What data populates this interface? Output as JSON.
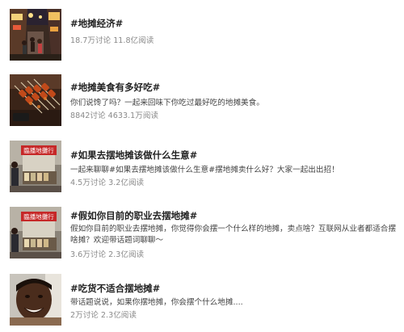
{
  "topics": [
    {
      "title": "#地摊经济#",
      "desc": "",
      "stats": "18.7万讨论 11.8亿阅读",
      "thumb": "night-market-street-photo"
    },
    {
      "title": "#地摊美食有多好吃#",
      "desc": "你们说馋了吗？一起来回味下你吃过最好吃的地摊美食。",
      "stats": "8842讨论 4633.1万阅读",
      "thumb": "street-food-grill-photo"
    },
    {
      "title": "#如果去摆地摊该做什么生意#",
      "desc": "一起来聊聊#如果去摆地摊该做什么生意#摆地摊卖什么好？大家一起出出招！",
      "stats": "4.5万讨论 3.2亿阅读",
      "thumb": "market-stall-sign-photo",
      "sign": "臨播地攤行"
    },
    {
      "title": "#假如你目前的职业去摆地摊#",
      "desc": "假如你目前的职业去摆地摊，你觉得你会摆一个什么样的地摊，卖点啥？互联网从业者都适合摆啥摊？欢迎带话题词聊聊～",
      "stats": "3.6万讨论 2.3亿阅读",
      "thumb": "market-stall-sign-photo",
      "sign": "臨播地攤行"
    },
    {
      "title": "#吃货不适合摆地摊#",
      "desc": "带话题说说，如果你摆地摊，你会摆个什么地摊....",
      "stats": "2万讨论 2.3亿阅读",
      "thumb": "smiling-boy-photo"
    }
  ]
}
